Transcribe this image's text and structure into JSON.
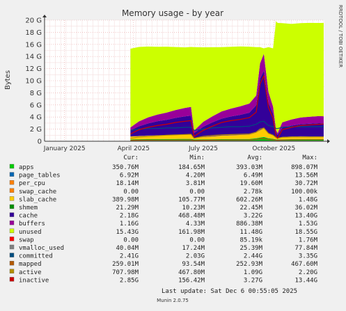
{
  "chart_data": {
    "type": "area",
    "title": "Memory usage - by year",
    "ylabel": "Bytes",
    "side_text": "RRDTOOL / TOBI OETIKER",
    "ylim": [
      0,
      20000000000
    ],
    "y_ticks": [
      {
        "value": 0,
        "label": "0"
      },
      {
        "value": 2000000000,
        "label": "2 G"
      },
      {
        "value": 4000000000,
        "label": "4 G"
      },
      {
        "value": 6000000000,
        "label": "6 G"
      },
      {
        "value": 8000000000,
        "label": "8 G"
      },
      {
        "value": 10000000000,
        "label": "10 G"
      },
      {
        "value": 12000000000,
        "label": "12 G"
      },
      {
        "value": 14000000000,
        "label": "14 G"
      },
      {
        "value": 16000000000,
        "label": "16 G"
      },
      {
        "value": 18000000000,
        "label": "18 G"
      },
      {
        "value": 20000000000,
        "label": "20 G"
      }
    ],
    "x_range": [
      "2024-12-06",
      "2025-12-06"
    ],
    "x_ticks": [
      {
        "date": "2025-01-01",
        "label": "January 2025"
      },
      {
        "date": "2025-04-01",
        "label": "April 2025"
      },
      {
        "date": "2025-07-01",
        "label": "July 2025"
      },
      {
        "date": "2025-10-01",
        "label": "October 2025"
      }
    ],
    "grid": true,
    "x": [
      "2025-03-28",
      "2025-04-08",
      "2025-04-20",
      "2025-05-02",
      "2025-05-14",
      "2025-05-26",
      "2025-06-07",
      "2025-06-15",
      "2025-06-19",
      "2025-07-01",
      "2025-07-13",
      "2025-07-25",
      "2025-08-06",
      "2025-08-18",
      "2025-08-30",
      "2025-09-08",
      "2025-09-13",
      "2025-09-18",
      "2025-09-24",
      "2025-09-30",
      "2025-10-04",
      "2025-10-06",
      "2025-10-12",
      "2025-10-24",
      "2025-11-05",
      "2025-11-17",
      "2025-11-29",
      "2025-12-05"
    ],
    "series": [
      {
        "name": "apps",
        "color": "#00cc00",
        "values": [
          0.3,
          0.33,
          0.35,
          0.35,
          0.36,
          0.37,
          0.38,
          0.38,
          0.3,
          0.32,
          0.33,
          0.34,
          0.35,
          0.36,
          0.37,
          0.5,
          0.6,
          0.7,
          0.5,
          0.4,
          0.3,
          0.3,
          0.32,
          0.34,
          0.35,
          0.36,
          0.35,
          0.35
        ]
      },
      {
        "name": "page_tables",
        "color": "#0066b3",
        "values": [
          0.005,
          0.006,
          0.006,
          0.006,
          0.007,
          0.007,
          0.007,
          0.007,
          0.006,
          0.006,
          0.006,
          0.007,
          0.007,
          0.007,
          0.007,
          0.008,
          0.01,
          0.012,
          0.008,
          0.007,
          0.006,
          0.006,
          0.006,
          0.007,
          0.007,
          0.007,
          0.007,
          0.007
        ]
      },
      {
        "name": "per_cpu",
        "color": "#ff8000",
        "values": [
          0.018,
          0.018,
          0.018,
          0.018,
          0.018,
          0.018,
          0.018,
          0.018,
          0.018,
          0.018,
          0.018,
          0.018,
          0.018,
          0.018,
          0.018,
          0.018,
          0.018,
          0.018,
          0.018,
          0.018,
          0.018,
          0.018,
          0.018,
          0.018,
          0.018,
          0.018,
          0.018,
          0.018
        ]
      },
      {
        "name": "swap_cache",
        "color": "#ffcc00",
        "values": [
          0,
          0,
          0,
          0,
          0,
          0,
          0,
          0,
          0,
          0,
          0,
          0,
          0,
          0,
          0,
          0,
          0,
          0,
          0,
          0,
          0,
          0,
          0,
          0,
          0,
          0,
          0,
          0
        ]
      },
      {
        "name": "slab_cache",
        "color": "#ffcc00",
        "values": [
          0.45,
          0.5,
          0.55,
          0.6,
          0.62,
          0.65,
          0.68,
          0.7,
          0.2,
          0.35,
          0.45,
          0.55,
          0.6,
          0.65,
          0.7,
          0.9,
          1.2,
          1.4,
          0.8,
          0.6,
          0.3,
          0.2,
          0.35,
          0.4,
          0.42,
          0.4,
          0.39,
          0.39
        ]
      },
      {
        "name": "shmem",
        "color": "#330099",
        "values": [
          0.02,
          0.02,
          0.02,
          0.02,
          0.02,
          0.02,
          0.02,
          0.02,
          0.02,
          0.02,
          0.02,
          0.02,
          0.02,
          0.02,
          0.02,
          0.02,
          0.02,
          0.02,
          0.02,
          0.02,
          0.02,
          0.02,
          0.02,
          0.02,
          0.02,
          0.02,
          0.02,
          0.02
        ]
      },
      {
        "name": "cache",
        "color": "#330099",
        "values": [
          1.0,
          1.6,
          2.0,
          2.3,
          2.5,
          2.8,
          3.0,
          3.1,
          0.8,
          1.7,
          2.3,
          2.8,
          3.1,
          3.3,
          3.6,
          4.5,
          8.5,
          9.5,
          5.0,
          3.5,
          0.8,
          0.5,
          1.5,
          1.8,
          2.0,
          2.1,
          2.2,
          2.18
        ]
      },
      {
        "name": "buffers",
        "color": "#990099",
        "values": [
          0.5,
          0.8,
          1.0,
          1.1,
          1.2,
          1.3,
          1.4,
          1.45,
          0.4,
          0.8,
          1.0,
          1.2,
          1.3,
          1.4,
          1.5,
          1.6,
          2.5,
          2.8,
          1.8,
          1.2,
          0.4,
          0.3,
          0.9,
          1.0,
          1.1,
          1.15,
          1.16,
          1.16
        ]
      },
      {
        "name": "unused",
        "color": "#ccff00",
        "values": [
          13.0,
          12.3,
          11.7,
          11.2,
          10.9,
          10.4,
          10.0,
          9.9,
          13.8,
          12.3,
          11.4,
          10.6,
          10.2,
          9.9,
          9.4,
          8.0,
          2.7,
          0.9,
          7.4,
          9.6,
          18.0,
          18.2,
          16.4,
          15.8,
          15.6,
          15.5,
          15.4,
          15.43
        ]
      },
      {
        "name": "swap",
        "color": "#ff0000",
        "values": [
          0,
          0,
          0,
          0,
          0,
          0,
          0,
          0,
          0,
          0,
          0,
          0,
          0,
          0,
          0,
          0,
          0,
          0,
          0,
          0,
          0,
          0,
          0,
          0,
          0,
          0,
          0,
          0
        ]
      },
      {
        "name": "vmalloc_used",
        "color": "#808080",
        "values": [
          0.03,
          0.03,
          0.03,
          0.03,
          0.03,
          0.03,
          0.03,
          0.03,
          0.03,
          0.03,
          0.03,
          0.03,
          0.03,
          0.03,
          0.03,
          0.03,
          0.03,
          0.03,
          0.03,
          0.03,
          0.03,
          0.03,
          0.03,
          0.03,
          0.03,
          0.03,
          0.03,
          0.04
        ]
      },
      {
        "name": "committed",
        "color": "#004d80",
        "values": [
          1.8,
          2.0,
          2.1,
          2.1,
          2.2,
          2.2,
          2.3,
          2.3,
          1.8,
          2.0,
          2.2,
          2.3,
          2.4,
          2.4,
          2.5,
          2.8,
          3.2,
          3.3,
          2.6,
          2.4,
          2.1,
          2.1,
          2.3,
          2.4,
          2.4,
          2.4,
          2.4,
          2.41
        ]
      },
      {
        "name": "mapped",
        "color": "#b35900",
        "values": [
          0.15,
          0.17,
          0.18,
          0.19,
          0.2,
          0.2,
          0.21,
          0.22,
          0.12,
          0.16,
          0.18,
          0.2,
          0.21,
          0.22,
          0.23,
          0.3,
          0.4,
          0.45,
          0.3,
          0.25,
          0.2,
          0.15,
          0.22,
          0.24,
          0.25,
          0.26,
          0.26,
          0.26
        ]
      },
      {
        "name": "active",
        "color": "#b38f00",
        "values": [
          0.5,
          0.7,
          0.8,
          0.9,
          1.0,
          1.05,
          1.1,
          1.15,
          0.5,
          0.8,
          0.95,
          1.05,
          1.1,
          1.15,
          1.2,
          1.5,
          2.0,
          2.2,
          1.3,
          1.0,
          0.6,
          0.5,
          0.65,
          0.7,
          0.7,
          0.7,
          0.71,
          0.71
        ]
      },
      {
        "name": "inactive",
        "color": "#cc0000",
        "values": [
          1.2,
          1.9,
          2.3,
          2.6,
          2.8,
          3.1,
          3.3,
          3.4,
          0.8,
          1.8,
          2.5,
          3.1,
          3.4,
          3.6,
          3.9,
          4.8,
          9.5,
          10.8,
          5.6,
          3.8,
          0.8,
          0.5,
          1.9,
          2.3,
          2.6,
          2.7,
          2.8,
          2.85
        ]
      }
    ],
    "legend": {
      "headers": [
        "Cur:",
        "Min:",
        "Avg:",
        "Max:"
      ],
      "rows": [
        {
          "name": "apps",
          "color": "#00cc00",
          "cur": "350.76M",
          "min": "184.65M",
          "avg": "393.03M",
          "max": "898.07M"
        },
        {
          "name": "page_tables",
          "color": "#0066b3",
          "cur": "6.92M",
          "min": "4.20M",
          "avg": "6.49M",
          "max": "13.56M"
        },
        {
          "name": "per_cpu",
          "color": "#ff8000",
          "cur": "18.14M",
          "min": "3.81M",
          "avg": "19.60M",
          "max": "30.72M"
        },
        {
          "name": "swap_cache",
          "color": "#ff8000",
          "cur": "0.00",
          "min": "0.00",
          "avg": "2.78k",
          "max": "100.00k"
        },
        {
          "name": "slab_cache",
          "color": "#ffcc00",
          "cur": "389.98M",
          "min": "105.77M",
          "avg": "602.26M",
          "max": "1.48G"
        },
        {
          "name": "shmem",
          "color": "#008f00",
          "cur": "21.29M",
          "min": "10.23M",
          "avg": "22.45M",
          "max": "36.02M"
        },
        {
          "name": "cache",
          "color": "#330099",
          "cur": "2.18G",
          "min": "468.48M",
          "avg": "3.22G",
          "max": "13.40G"
        },
        {
          "name": "buffers",
          "color": "#990099",
          "cur": "1.16G",
          "min": "4.33M",
          "avg": "886.38M",
          "max": "1.53G"
        },
        {
          "name": "unused",
          "color": "#ccff00",
          "cur": "15.43G",
          "min": "161.98M",
          "avg": "11.48G",
          "max": "18.55G"
        },
        {
          "name": "swap",
          "color": "#ff0000",
          "cur": "0.00",
          "min": "0.00",
          "avg": "85.19k",
          "max": "1.76M"
        },
        {
          "name": "vmalloc_used",
          "color": "#808080",
          "cur": "40.04M",
          "min": "17.24M",
          "avg": "25.39M",
          "max": "77.84M"
        },
        {
          "name": "committed",
          "color": "#004d80",
          "cur": "2.41G",
          "min": "2.03G",
          "avg": "2.44G",
          "max": "3.35G"
        },
        {
          "name": "mapped",
          "color": "#b35900",
          "cur": "259.01M",
          "min": "93.54M",
          "avg": "252.93M",
          "max": "467.60M"
        },
        {
          "name": "active",
          "color": "#b38f00",
          "cur": "707.98M",
          "min": "467.80M",
          "avg": "1.09G",
          "max": "2.20G"
        },
        {
          "name": "inactive",
          "color": "#cc0000",
          "cur": "2.85G",
          "min": "156.42M",
          "avg": "3.27G",
          "max": "13.44G"
        }
      ]
    },
    "last_update": "Last update:  Sat Dec  6 00:55:05 2025",
    "footer": "Munin 2.0.75"
  }
}
